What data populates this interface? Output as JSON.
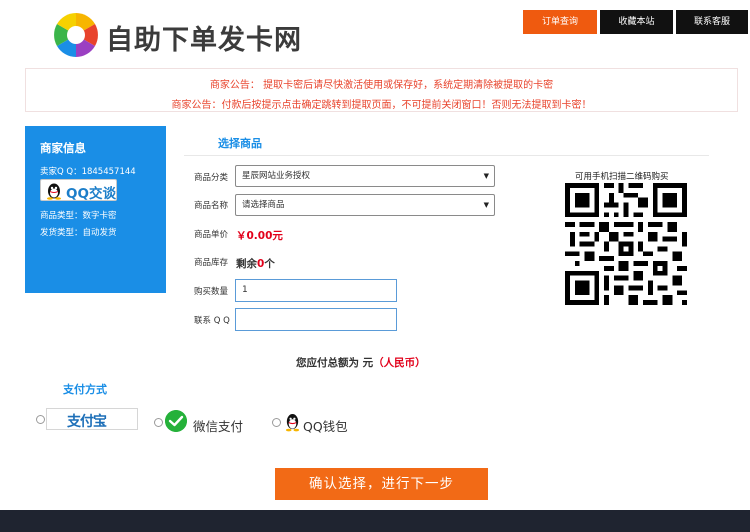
{
  "header": {
    "site_title": "自助下单发卡网",
    "nav": [
      {
        "label": "订单查询",
        "active": true
      },
      {
        "label": "收藏本站",
        "active": false
      },
      {
        "label": "联系客服",
        "active": false
      }
    ]
  },
  "notice": {
    "line1": "商家公告：  提取卡密后请尽快激活使用或保存好，系统定期清除被提取的卡密",
    "line2": "商家公告：付款后按提示点击确定跳转到提取页面，不可提前关闭窗口！否则无法提取到卡密！"
  },
  "merchant": {
    "title": "商家信息",
    "qq": "卖家Q Q：1845457144",
    "qq_button": "QQ交谈",
    "type": "商品类型：数字卡密",
    "ship": "发货类型：自动发货"
  },
  "goods": {
    "section_title": "选择商品",
    "category_label": "商品分类",
    "category_value": "星辰网站业务授权",
    "name_label": "商品名称",
    "name_value": "请选择商品",
    "price_label": "商品单价",
    "price_value": "￥0.00元",
    "stock_label": "商品库存",
    "stock_prefix": "剩余",
    "stock_num": "0",
    "stock_suffix": "个",
    "qty_label": "购买数量",
    "qty_value": "1",
    "contact_label": "联系 Q Q",
    "contact_value": ""
  },
  "qr": {
    "title": "可用手机扫描二维码购买"
  },
  "total": {
    "prefix": "您应付总额为 元",
    "currency": "（人民币）"
  },
  "payment": {
    "title": "支付方式",
    "alipay_label": "支付宝",
    "wechat_label": "微信支付",
    "qq_label": "QQ钱包"
  },
  "submit_label": "确认选择，进行下一步",
  "colors": {
    "accent_blue": "#1a8ee6",
    "accent_orange": "#f26a16",
    "price_red": "#e2001a"
  }
}
